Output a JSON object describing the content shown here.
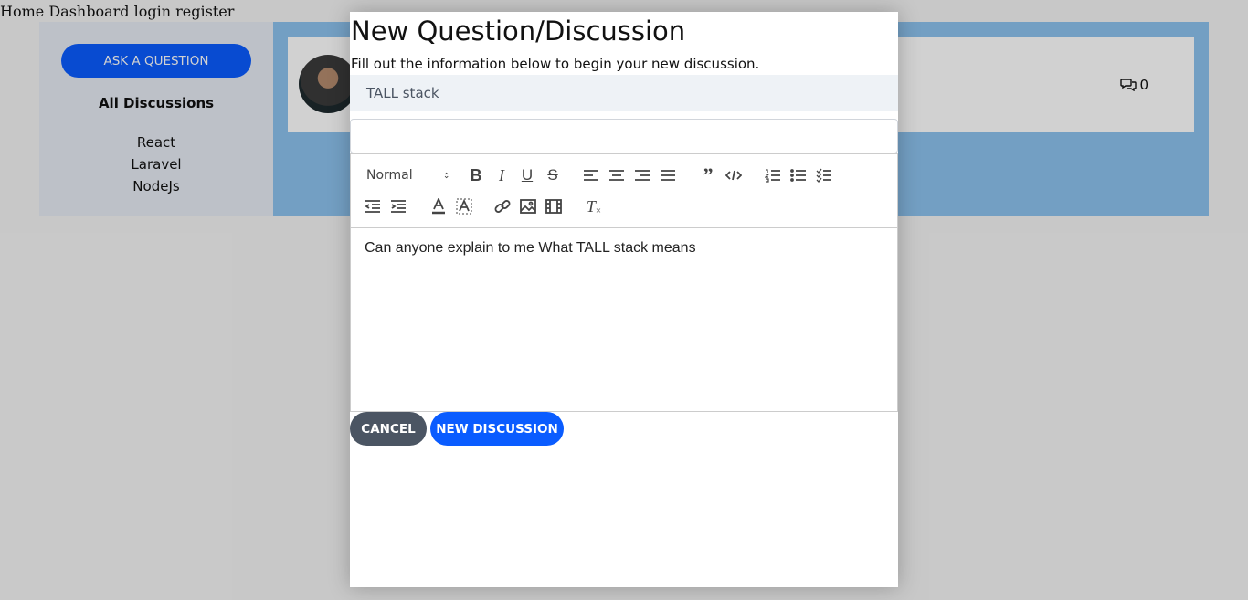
{
  "topnav": {
    "links": [
      "Home",
      "Dashboard",
      "login",
      "register"
    ]
  },
  "sidebar": {
    "ask_button": "ASK A QUESTION",
    "all_discussions": "All Discussions",
    "categories": [
      "React",
      "Laravel",
      "NodeJs"
    ]
  },
  "post": {
    "comment_count": "0"
  },
  "modal": {
    "title": "New Question/Discussion",
    "subtitle": "Fill out the information below to begin your new discussion.",
    "category_selected": "TALL stack",
    "title_value": "",
    "editor": {
      "header_format": "Normal",
      "content": "Can anyone explain to me What TALL stack means"
    },
    "cancel_label": "CANCEL",
    "submit_label": "NEW DISCUSSION"
  },
  "colors": {
    "primary": "#0a5cff",
    "secondary": "#4b5563",
    "sidebar_bg": "#e7ecf4",
    "main_bg": "#8dc3ee"
  },
  "icons": {
    "toolbar_row1": [
      "bold-icon",
      "italic-icon",
      "underline-icon",
      "strike-icon",
      "align-left-icon",
      "align-center-icon",
      "align-right-icon",
      "align-justify-icon",
      "blockquote-icon",
      "code-block-icon",
      "ordered-list-icon",
      "bullet-list-icon",
      "check-list-icon"
    ],
    "toolbar_row2": [
      "outdent-icon",
      "indent-icon",
      "text-color-icon",
      "background-color-icon",
      "link-icon",
      "image-icon",
      "video-icon",
      "clear-format-icon"
    ]
  }
}
